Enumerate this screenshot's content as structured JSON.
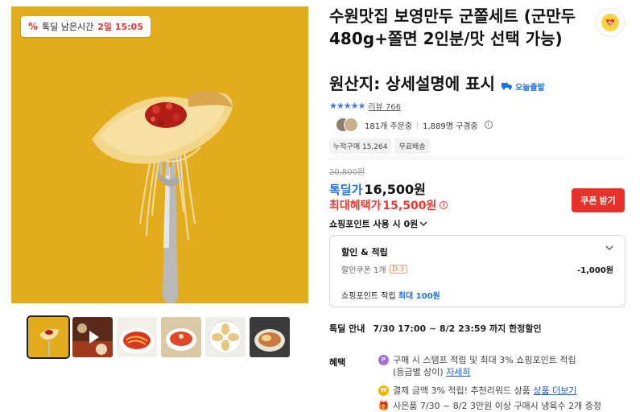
{
  "gallery": {
    "deal_timer": {
      "icon": "percent-icon",
      "prefix": "%",
      "label": "톡딜 남은시간",
      "remaining": "2일 15:05"
    },
    "thumbnails": [
      {
        "name": "thumb-1",
        "icon": "dumpling-fork-thumb",
        "active": true
      },
      {
        "name": "thumb-2",
        "icon": "video-thumb"
      },
      {
        "name": "thumb-3",
        "icon": "spicy-noodle-thumb"
      },
      {
        "name": "thumb-4",
        "icon": "noodle-bowl-thumb"
      },
      {
        "name": "thumb-5",
        "icon": "dumpling-plate-thumb"
      },
      {
        "name": "thumb-6",
        "icon": "dumpling-bowl-thumb"
      }
    ]
  },
  "product": {
    "title": "수원맛집 보영만두 군쫄세트 (군만두 480g+쫄면 2인분/맛 선택 가능)",
    "origin": "원산지: 상세설명에 표시",
    "today_ship": "오늘출발",
    "wishlist_icon": "heart-icon",
    "rating": {
      "stars": "★★★★★",
      "review_label": "리뷰 766"
    },
    "social": {
      "ordering": "181개 주문중",
      "watching": "1,889명 구경중"
    },
    "chips": [
      "누적구매 15,264",
      "무료배송"
    ]
  },
  "price": {
    "original": "20,800원",
    "deal_label": "톡딜가",
    "deal_value": "16,500원",
    "max_label": "최대혜택가",
    "max_value": "15,500원",
    "coupon_button": "쿠폰 받기",
    "points_use": "쇼핑포인트 사용 시 0원"
  },
  "discount": {
    "header": "할인 & 적립",
    "coupon_label": "할인쿠폰 1개",
    "coupon_dday": "D-3",
    "coupon_amount": "-1,000원",
    "points_prefix": "쇼핑포인트 적립",
    "points_highlight": "최대 100원"
  },
  "deal_info": {
    "label": "톡딜 안내",
    "text": "7/30 17:00 ~ 8/2 23:59 까지 한정할인"
  },
  "benefits": {
    "label": "혜택",
    "items": [
      {
        "icon": "point-icon",
        "badge": "P",
        "text": "구매 시 스탬프 적립 및 최대 3% 쇼핑포인트 적립",
        "text2": "(등급별 상이)",
        "link": "자세히",
        "color": "#a36bdc"
      },
      {
        "icon": "pay-icon",
        "badge": "₩",
        "text": "결제 금액 3% 적립! 추천리워드 상품",
        "link": "상품 더보기",
        "color": "#f3b400"
      },
      {
        "icon": "gift-icon",
        "badge": "🎁",
        "text": "사은품 7/30 ~ 8/2 3만원 이상 구매시 냉육수 2개 증정",
        "link": "",
        "color": "#e8372c"
      }
    ]
  },
  "colors": {
    "accent_red": "#e8312a",
    "accent_blue": "#1a73e8",
    "hero_bg": "#e2ac1d"
  }
}
